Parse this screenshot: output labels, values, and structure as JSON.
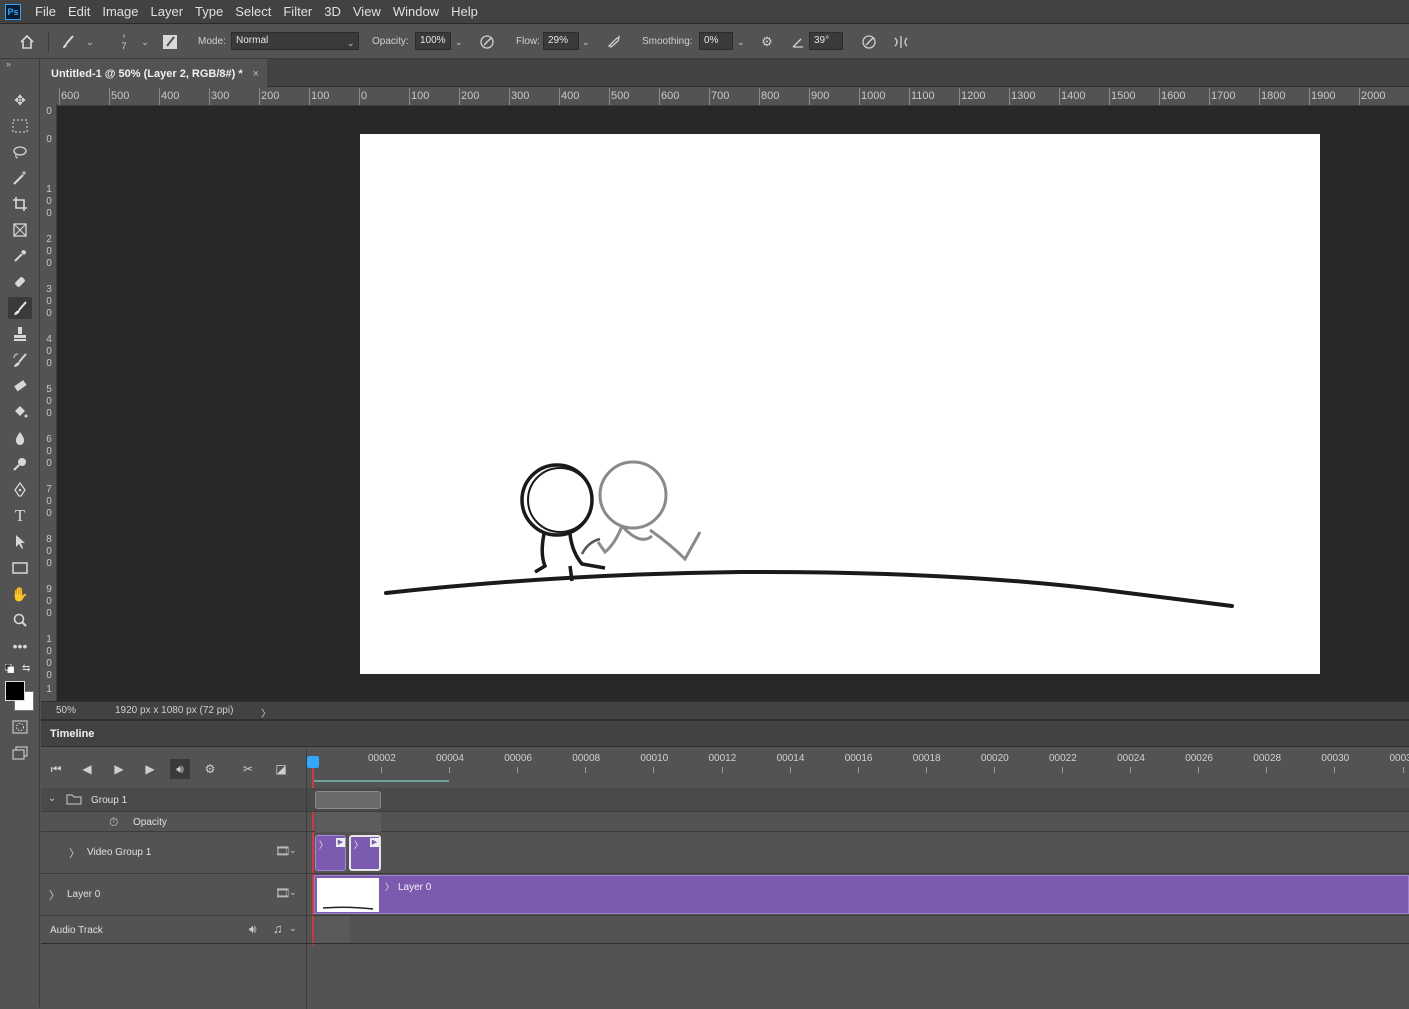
{
  "app_icon": "Ps",
  "menu": [
    "File",
    "Edit",
    "Image",
    "Layer",
    "Type",
    "Select",
    "Filter",
    "3D",
    "View",
    "Window",
    "Help"
  ],
  "options": {
    "brush_size": "7",
    "mode_label": "Mode:",
    "mode_value": "Normal",
    "opacity_label": "Opacity:",
    "opacity_value": "100%",
    "flow_label": "Flow:",
    "flow_value": "29%",
    "smoothing_label": "Smoothing:",
    "smoothing_value": "0%",
    "angle_value": "39°"
  },
  "document": {
    "tab_title": "Untitled-1 @ 50% (Layer 2, RGB/8#) *",
    "close": "×"
  },
  "ruler_top": [
    "600",
    "500",
    "400",
    "300",
    "200",
    "100",
    "0",
    "100",
    "200",
    "300",
    "400",
    "500",
    "600",
    "700",
    "800",
    "900",
    "1000",
    "1100",
    "1200",
    "1300",
    "1400",
    "1500",
    "1600",
    "1700",
    "1800",
    "1900",
    "2000"
  ],
  "ruler_left": [
    "0",
    "0",
    "1\n0\n0",
    "2\n0\n0",
    "3\n0\n0",
    "4\n0\n0",
    "5\n0\n0",
    "6\n0\n0",
    "7\n0\n0",
    "8\n0\n0",
    "9\n0\n0",
    "1\n0\n0\n0",
    "1"
  ],
  "status": {
    "zoom": "50%",
    "doc_size": "1920 px x 1080 px (72 ppi)",
    "arrow": "〉"
  },
  "timeline": {
    "title": "Timeline",
    "frames": [
      "00002",
      "00004",
      "00006",
      "00008",
      "00010",
      "00012",
      "00014",
      "00016",
      "00018",
      "00020",
      "00022",
      "00024",
      "00026",
      "00028",
      "00030",
      "0003"
    ],
    "tracks": {
      "group1": "Group 1",
      "opacity": "Opacity",
      "video_group": "Video Group 1",
      "layer0": "Layer 0",
      "layer0_clip": "Layer 0",
      "audio": "Audio Track"
    }
  },
  "colors": {
    "accent": "#31a8ff",
    "clip": "#7b5bb0",
    "playhead": "#d03a3a"
  }
}
